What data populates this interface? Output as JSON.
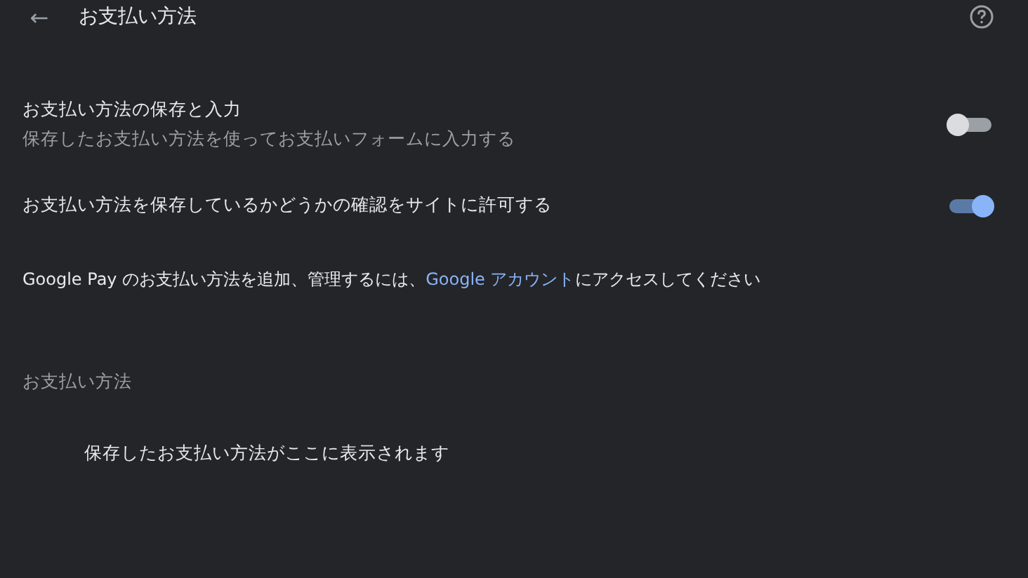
{
  "header": {
    "back_icon": "←",
    "title": "お支払い方法"
  },
  "settings": [
    {
      "label": "お支払い方法の保存と入力",
      "description": "保存したお支払い方法を使ってお支払いフォームに入力する",
      "on": false
    },
    {
      "label": "お支払い方法を保存しているかどうかの確認をサイトに許可する",
      "on": true
    }
  ],
  "google_pay_note": {
    "text_before": "Google Pay のお支払い方法を追加、管理するには、",
    "link": "Google アカウント",
    "text_after": "にアクセスしてください"
  },
  "payment_methods": {
    "heading": "お支払い方法",
    "empty_message": "保存したお支払い方法がここに表示されます"
  }
}
